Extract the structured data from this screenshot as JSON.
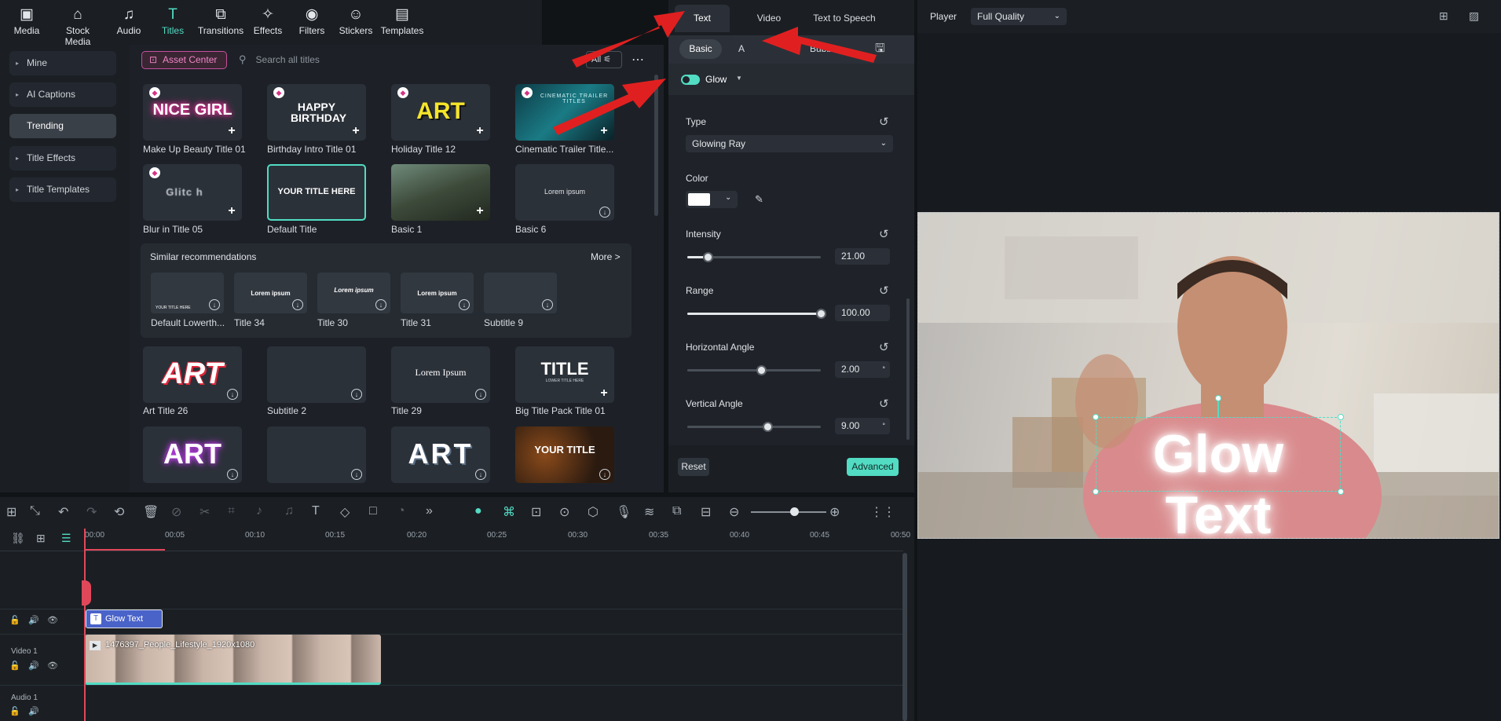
{
  "toolbar": {
    "items": [
      {
        "label": "Media",
        "icon": "media-icon"
      },
      {
        "label": "Stock Media",
        "icon": "stock-media-icon"
      },
      {
        "label": "Audio",
        "icon": "audio-icon"
      },
      {
        "label": "Titles",
        "icon": "titles-icon"
      },
      {
        "label": "Transitions",
        "icon": "transitions-icon"
      },
      {
        "label": "Effects",
        "icon": "effects-icon"
      },
      {
        "label": "Filters",
        "icon": "filters-icon"
      },
      {
        "label": "Stickers",
        "icon": "stickers-icon"
      },
      {
        "label": "Templates",
        "icon": "templates-icon"
      }
    ],
    "active": "Titles"
  },
  "sidebar": {
    "items": [
      {
        "label": "Mine"
      },
      {
        "label": "AI Captions"
      },
      {
        "label": "Trending"
      },
      {
        "label": "Title Effects"
      },
      {
        "label": "Title Templates"
      }
    ]
  },
  "grid": {
    "asset_center": "Asset Center",
    "search_placeholder": "Search all titles",
    "filter_label": "All",
    "row1": [
      {
        "label": "Make Up Beauty Title 01",
        "art": "NICE GIRL"
      },
      {
        "label": "Birthday Intro Title 01",
        "art": "HAPPY BIRTHDAY"
      },
      {
        "label": "Holiday Title 12",
        "art": "ART"
      },
      {
        "label": "Cinematic Trailer Title...",
        "art": "CINEMATIC TRAILER TITLES"
      }
    ],
    "row2": [
      {
        "label": "Blur in Title 05",
        "art": "Glitc h"
      },
      {
        "label": "Default Title",
        "art": "YOUR TITLE HERE"
      },
      {
        "label": "Basic 1",
        "art": ""
      },
      {
        "label": "Basic 6",
        "art": "Lorem ipsum"
      }
    ],
    "similar": {
      "title": "Similar recommendations",
      "more": "More >",
      "items": [
        {
          "label": "Default Lowerth...",
          "art": "YOUR TITLE HERE"
        },
        {
          "label": "Title 34",
          "art": "Lorem ipsum"
        },
        {
          "label": "Title 30",
          "art": "Lorem ipsum"
        },
        {
          "label": "Title 31",
          "art": "Lorem ipsum"
        },
        {
          "label": "Subtitle 9",
          "art": ""
        }
      ]
    },
    "row3": [
      {
        "label": "Art Title 26",
        "art": "ART"
      },
      {
        "label": "Subtitle 2",
        "art": ""
      },
      {
        "label": "Title 29",
        "art": "Lorem Ipsum"
      },
      {
        "label": "Big Title Pack Title 01",
        "art": "TITLE",
        "sub": "LOWER TITLE HERE"
      }
    ],
    "row4": [
      {
        "art": "ART"
      },
      {
        "art": ""
      },
      {
        "art": "ART"
      },
      {
        "art": "YOUR TITLE"
      }
    ]
  },
  "props": {
    "tabs": [
      "Text",
      "Video",
      "Text to Speech"
    ],
    "subtabs": [
      "Basic",
      "A",
      "Bubble"
    ],
    "glow_label": "Glow",
    "type_label": "Type",
    "type_value": "Glowing Ray",
    "color_label": "Color",
    "color_value": "#ffffff",
    "intensity_label": "Intensity",
    "intensity_value": "21.00",
    "intensity_level": 0.15,
    "range_label": "Range",
    "range_value": "100.00",
    "range_level": 1.0,
    "hangle_label": "Horizontal Angle",
    "hangle_value": "2.00",
    "hangle_level": 0.55,
    "vangle_label": "Vertical Angle",
    "vangle_value": "9.00",
    "vangle_level": 0.6,
    "degree": "°",
    "reset": "Reset",
    "advanced": "Advanced"
  },
  "player": {
    "label": "Player",
    "quality": "Full Quality",
    "overlay_text": "Glow Text"
  },
  "timeline": {
    "ticks": [
      "00:00",
      "00:05",
      "00:10",
      "00:15",
      "00:20",
      "00:25",
      "00:30",
      "00:35",
      "00:40",
      "00:45",
      "00:50"
    ],
    "title_clip": "Glow Text",
    "video_clip": "1476397_People_Lifestyle_1920x1080",
    "video_track": "Video 1",
    "audio_track": "Audio 1"
  },
  "accent": "#52dcc3"
}
